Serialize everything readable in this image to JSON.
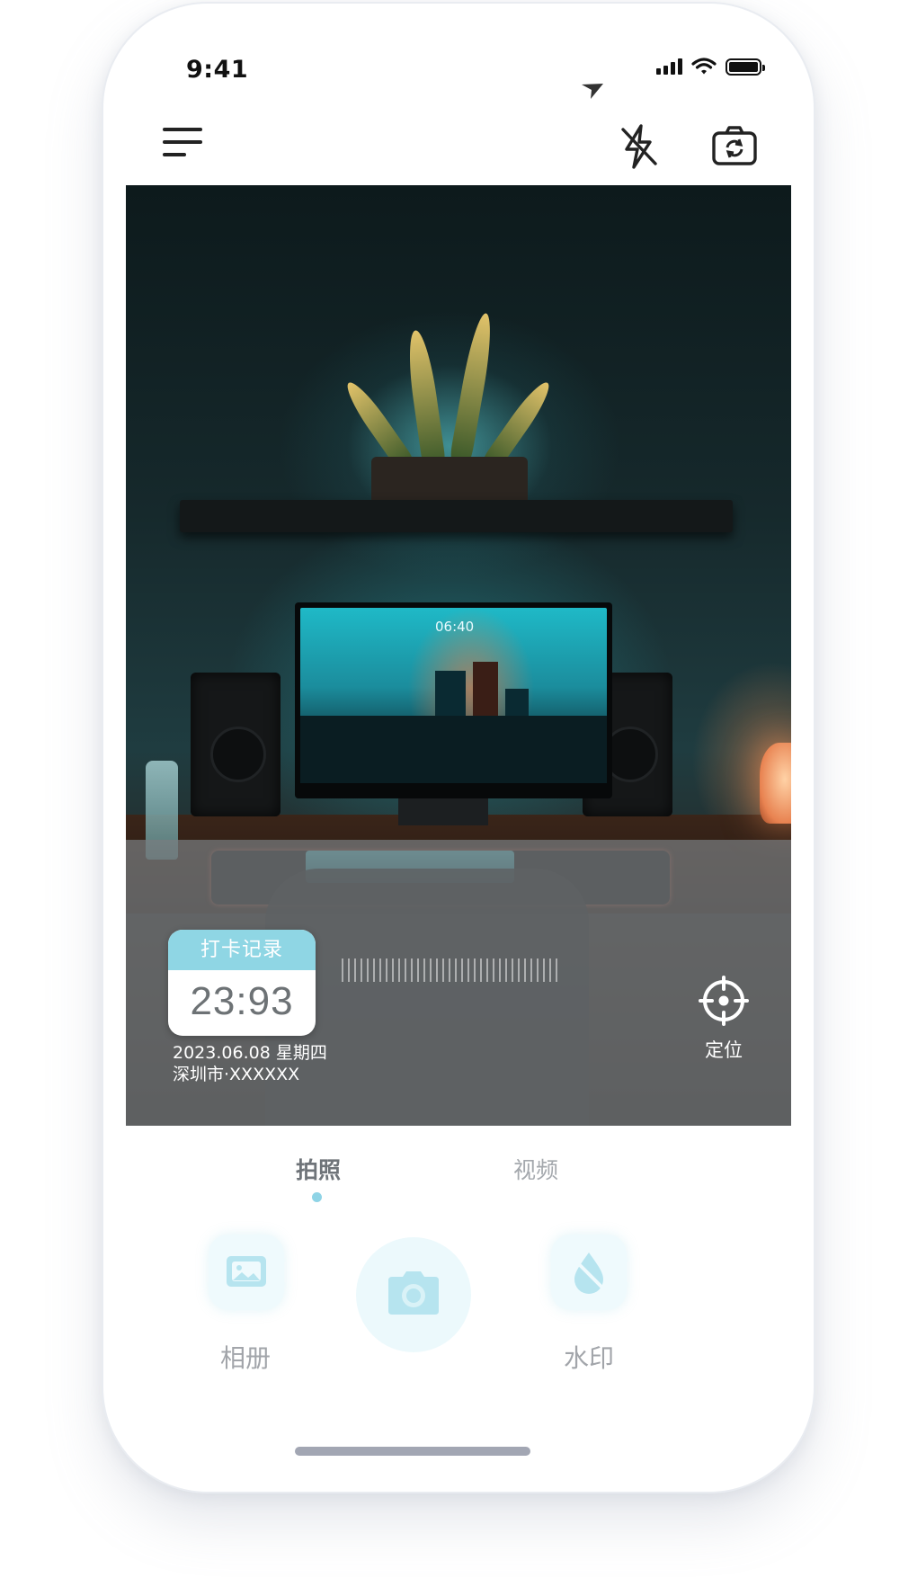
{
  "status_bar": {
    "time": "9:41"
  },
  "toolbar": {
    "menu_icon": "menu-icon",
    "flash_icon": "flash-off-icon",
    "flip_icon": "camera-flip-icon"
  },
  "viewfinder": {
    "monitor_clock": "06:40",
    "punch_card": {
      "header": "打卡记录",
      "time": "23:93"
    },
    "date": "2023.06.08 星期四",
    "location": "深圳市·XXXXXX",
    "locate_label": "定位"
  },
  "modes": {
    "photo": "拍照",
    "video": "视频",
    "active": "photo"
  },
  "actions": {
    "album": "相册",
    "watermark": "水印"
  },
  "colors": {
    "accent": "#8fd6e4",
    "tile_bg": "#effafd",
    "label": "#a2a5aa"
  }
}
